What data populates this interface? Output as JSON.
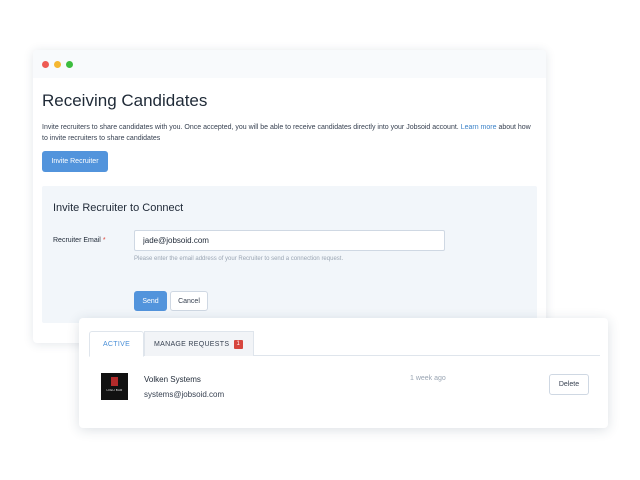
{
  "window": {
    "title": "Receiving Candidates",
    "description": "Invite recruiters to share candidates with you. Once accepted, you will be able to receive candidates directly into your Jobsoid account.",
    "learn_more_link": "Learn more",
    "description_tail": "about how to invite recruiters to share candidates",
    "invite_button": "Invite Recruiter"
  },
  "invite_form": {
    "title": "Invite Recruiter to Connect",
    "email_label": "Recruiter Email",
    "required_mark": "*",
    "email_value": "jade@jobsoid.com",
    "email_help": "Please enter the email address of your Recruiter to send a connection request.",
    "send_button": "Send",
    "cancel_button": "Cancel"
  },
  "recruiters": {
    "tabs": [
      {
        "label": "ACTIVE",
        "active": true
      },
      {
        "label": "MANAGE REQUESTS",
        "badge": "1"
      }
    ],
    "items": [
      {
        "logo_text": "HIGH BAR",
        "name": "Volken Systems",
        "email": "systems@jobsoid.com",
        "time": "1 week ago",
        "delete_button": "Delete"
      }
    ]
  },
  "colors": {
    "accent": "#5294dc",
    "badge": "#d7463e",
    "panel": "#f2f6fa"
  }
}
